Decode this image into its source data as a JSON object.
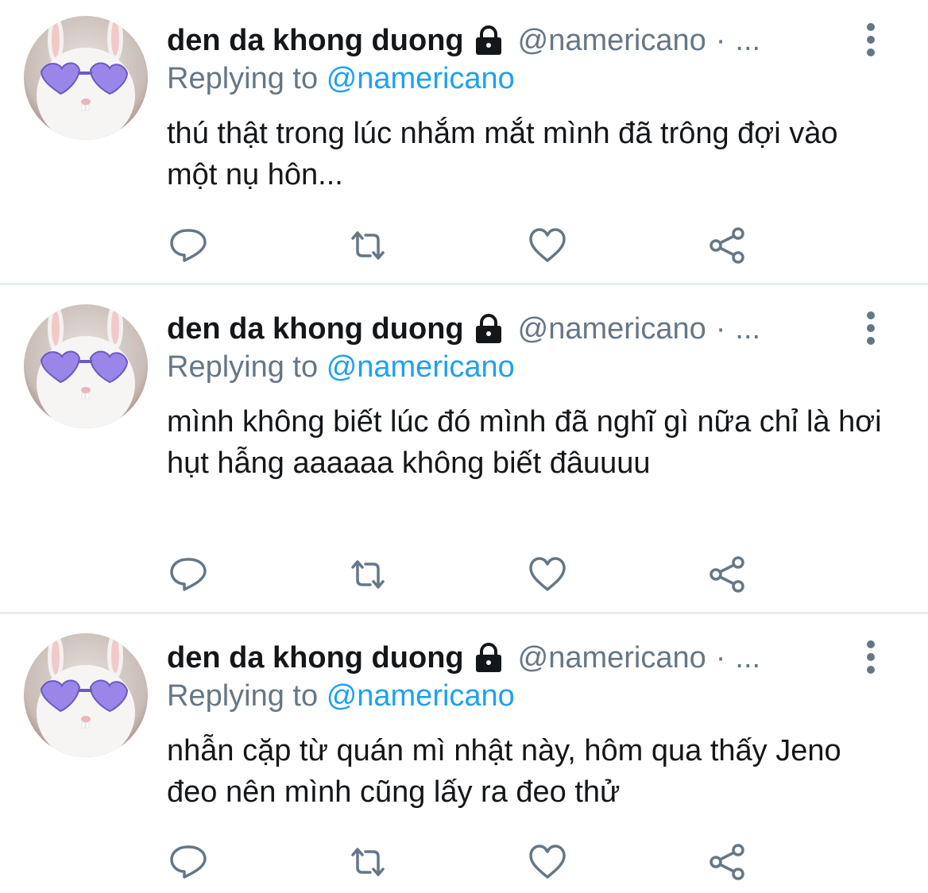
{
  "tweets": [
    {
      "display_name": "den da khong duong",
      "handle": "@namericano",
      "separator": "·",
      "ellipsis": "...",
      "reply_prefix": "Replying to",
      "reply_to": "@namericano",
      "text": "thú thật trong lúc nhắm mắt mình đã trông đợi vào một nụ hôn..."
    },
    {
      "display_name": "den da khong duong",
      "handle": "@namericano",
      "separator": "·",
      "ellipsis": "...",
      "reply_prefix": "Replying to",
      "reply_to": "@namericano",
      "text": "mình không biết lúc đó mình đã nghĩ gì nữa chỉ là hơi hụt hẫng aaaaaa không biết đâuuuu"
    },
    {
      "display_name": "den da khong duong",
      "handle": "@namericano",
      "separator": "·",
      "ellipsis": "...",
      "reply_prefix": "Replying to",
      "reply_to": "@namericano",
      "text": "nhẫn cặp từ quán mì nhật này, hôm qua thấy Jeno đeo nên mình cũng lấy ra đeo thử"
    }
  ],
  "icons": {
    "lock": "lock-icon",
    "more": "more-vertical-icon",
    "reply": "reply-icon",
    "retweet": "retweet-icon",
    "like": "heart-icon",
    "share": "share-icon"
  },
  "colors": {
    "text": "#14171a",
    "secondary": "#657786",
    "link": "#1da1f2",
    "divider": "#e6ecf0",
    "avatar_bg": "#c9c0bb",
    "heart_glasses": "#9a85e8"
  }
}
